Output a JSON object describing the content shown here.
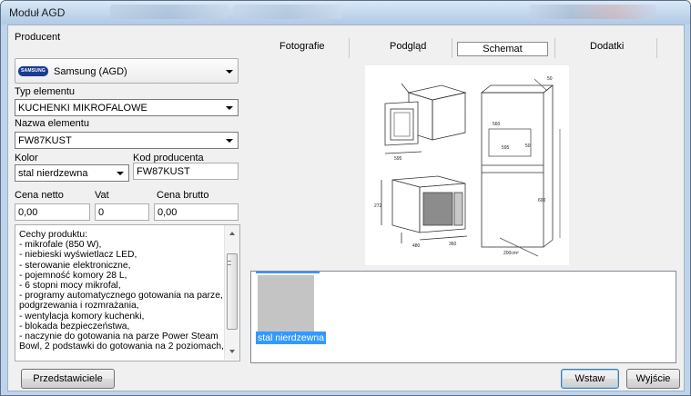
{
  "window": {
    "title": "Moduł AGD"
  },
  "form": {
    "producer_label": "Producent",
    "producer_value": "Samsung (AGD)",
    "producer_logo": "SAMSUNG",
    "type_label": "Typ elementu",
    "type_value": "KUCHENKI MIKROFALOWE",
    "name_label": "Nazwa elementu",
    "name_value": "FW87KUST",
    "color_label": "Kolor",
    "color_value": "stal nierdzewna",
    "code_label": "Kod producenta",
    "code_value": "FW87KUST",
    "net_label": "Cena netto",
    "net_value": "0,00",
    "vat_label": "Vat",
    "vat_value": "0",
    "gross_label": "Cena brutto",
    "gross_value": "0,00",
    "features": [
      "Cechy produktu:",
      "- mikrofale (850 W),",
      "- niebieski wyświetlacz LED,",
      "- sterowanie elektroniczne,",
      "- pojemność komory 28 L,",
      "- 6 stopni mocy mikrofal,",
      "- programy automatycznego gotowania na parze,",
      "podgrzewania i rozmrażania,",
      "- wentylacja komory kuchenki,",
      "- blokada bezpieczeństwa,",
      "- naczynie do gotowania na parze Power Steam",
      "Bowl, 2 podstawki do gotowania na 2 poziomach,"
    ]
  },
  "tabs": [
    {
      "label": "Fotografie"
    },
    {
      "label": "Podgląd"
    },
    {
      "label": "Schemat"
    },
    {
      "label": "Dodatki"
    }
  ],
  "gallery": {
    "caption": "stal nierdzewna"
  },
  "buttons": {
    "representatives": "Przedstawiciele",
    "insert": "Wstaw",
    "exit": "Wyjście"
  },
  "colors": {
    "selection": "#3399ff",
    "client_bg": "#f0f0f0",
    "title_bar": "#c6d9ef"
  },
  "icons": {
    "dropdown": "chevron-down-icon",
    "scroll_up": "arrow-up-icon",
    "scroll_down": "arrow-down-icon"
  }
}
